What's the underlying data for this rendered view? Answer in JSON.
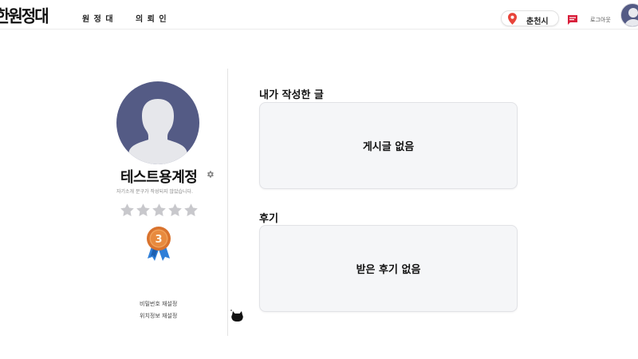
{
  "header": {
    "logo": "한원정대",
    "nav": [
      {
        "label": "원 정 대"
      },
      {
        "label": "의 뢰 인"
      }
    ],
    "location": "춘천시",
    "logout_label": "로그아웃",
    "brand_color": "#e8443a"
  },
  "profile": {
    "username": "테스트용계정",
    "intro": "자기소개 문구가 작성되지 않았습니다.",
    "rating": 0,
    "rating_max": 5,
    "rank_badge": "3",
    "links": [
      {
        "label": "비밀번호 재설정"
      },
      {
        "label": "위치정보 재설정"
      }
    ],
    "avatar_color": "#545b85"
  },
  "main": {
    "posts": {
      "title": "내가 작성한 글",
      "empty_text": "게시글 없음"
    },
    "reviews": {
      "title": "후기",
      "empty_text": "받은 후기 없음"
    }
  }
}
